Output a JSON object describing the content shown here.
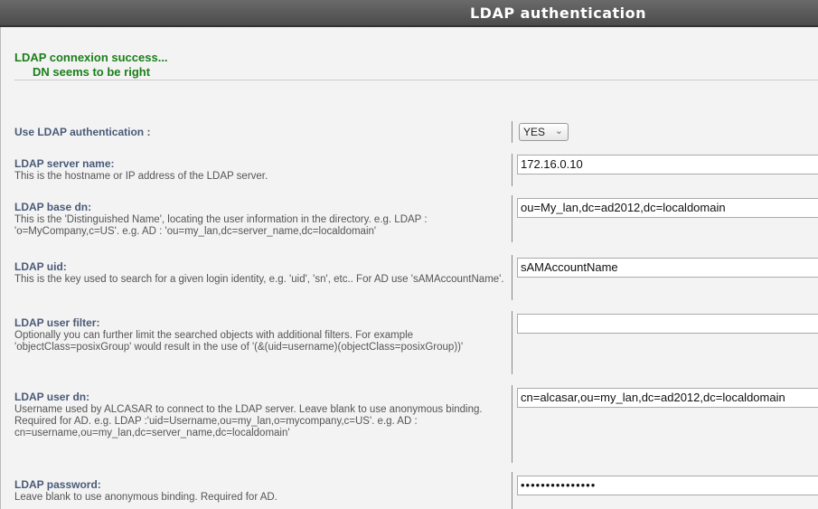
{
  "header": {
    "title": "LDAP authentication"
  },
  "status": {
    "line1": "LDAP connexion success...",
    "line2": "DN seems to be right"
  },
  "fields": {
    "use_ldap": {
      "label": "Use LDAP authentication :",
      "value": "YES"
    },
    "server": {
      "label": "LDAP server name:",
      "desc": "This is the hostname or IP address of the LDAP server.",
      "value": "172.16.0.10"
    },
    "base_dn": {
      "label": "LDAP base dn:",
      "desc": "This is the 'Distinguished Name', locating the user information in the directory. e.g. LDAP : 'o=MyCompany,c=US'. e.g. AD : 'ou=my_lan,dc=server_name,dc=localdomain'",
      "value": "ou=My_lan,dc=ad2012,dc=localdomain"
    },
    "uid": {
      "label": "LDAP uid:",
      "desc": "This is the key used to search for a given login identity, e.g. 'uid', 'sn', etc.. For AD use 'sAMAccountName'.",
      "value": "sAMAccountName"
    },
    "filter": {
      "label": "LDAP user filter:",
      "desc": "Optionally you can further limit the searched objects with additional filters. For example 'objectClass=posixGroup' would result in the use of '(&(uid=username)(objectClass=posixGroup))'",
      "value": ""
    },
    "user_dn": {
      "label": "LDAP user dn:",
      "desc": "Username used by ALCASAR to connect to the LDAP server. Leave blank to use anonymous binding. Required for AD. e.g. LDAP :'uid=Username,ou=my_lan,o=mycompany,c=US'. e.g. AD : cn=username,ou=my_lan,dc=server_name,dc=localdomain'",
      "value": "cn=alcasar,ou=my_lan,dc=ad2012,dc=localdomain"
    },
    "password": {
      "label": "LDAP password:",
      "desc": "Leave blank to use anonymous binding. Required for AD.",
      "value": "•••••••••••••••"
    }
  },
  "colors": {
    "title_bg": "#555555",
    "success": "#1a7f1a",
    "label": "#4a5a78"
  }
}
